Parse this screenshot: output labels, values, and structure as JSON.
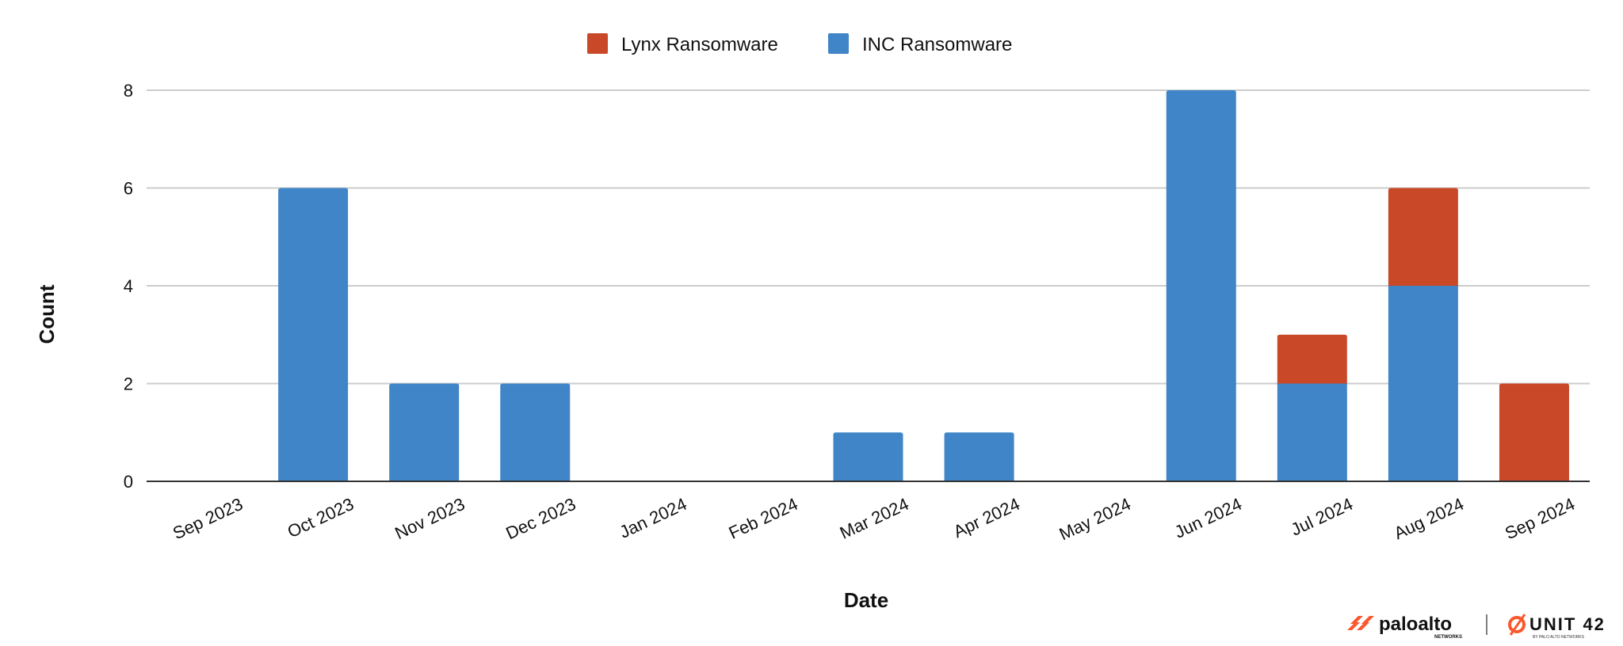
{
  "chart_data": {
    "type": "bar",
    "stacked": true,
    "title": "",
    "xlabel": "Date",
    "ylabel": "Count",
    "ylim": [
      0,
      8
    ],
    "yticks": [
      0,
      2,
      4,
      6,
      8
    ],
    "grid": true,
    "legend_position": "top-center",
    "categories": [
      "Sep 2023",
      "Oct 2023",
      "Nov 2023",
      "Dec 2023",
      "Jan 2024",
      "Feb 2024",
      "Mar 2024",
      "Apr 2024",
      "May 2024",
      "Jun 2024",
      "Jul 2024",
      "Aug 2024",
      "Sep 2024"
    ],
    "series": [
      {
        "name": "INC Ransomware",
        "color": "#3f85c7",
        "values": [
          0,
          6,
          2,
          2,
          0,
          0,
          1,
          1,
          0,
          8,
          2,
          4,
          0
        ]
      },
      {
        "name": "Lynx Ransomware",
        "color": "#c84828",
        "values": [
          0,
          0,
          0,
          0,
          0,
          0,
          0,
          0,
          0,
          0,
          1,
          2,
          2
        ]
      }
    ],
    "legend_order": [
      "Lynx Ransomware",
      "INC Ransomware"
    ]
  },
  "branding": {
    "paloalto": "paloalto",
    "paloalto_sub": "NETWORKS",
    "unit42": "UNIT 42",
    "unit42_sub": "BY PALO ALTO NETWORKS",
    "accent": "#fa582d"
  }
}
